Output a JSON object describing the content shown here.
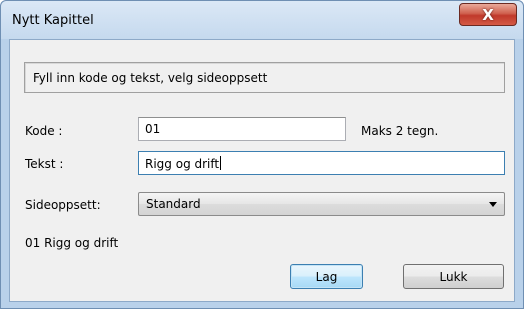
{
  "window": {
    "title": "Nytt Kapittel",
    "close_glyph": "X"
  },
  "form": {
    "instruction": "Fyll inn kode og tekst, velg sideoppsett",
    "kode_label": "Kode :",
    "kode_value": "01",
    "kode_hint": "Maks 2 tegn.",
    "tekst_label": "Tekst :",
    "tekst_value": "Rigg og drift",
    "sideoppsett_label": "Sideoppsett:",
    "sideoppsett_value": "Standard",
    "preview": "01 Rigg og drift"
  },
  "buttons": {
    "lag": "Lag",
    "lukk": "Lukk"
  },
  "colors": {
    "titlebar": "#c5d9ee",
    "close_button": "#c0392b",
    "client": "#f0f0f0",
    "focus_border": "#3c7fb1"
  }
}
